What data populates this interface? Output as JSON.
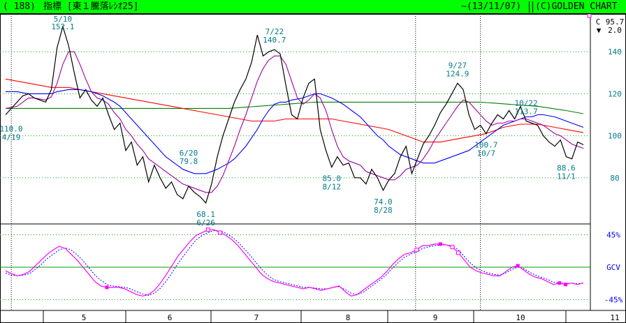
{
  "header": {
    "code": "( 188)",
    "title": "指標 [東１騰落ﾚｼｵ25]",
    "date": "~(13/11/07)",
    "brand": "(C)GOLDEN CHART"
  },
  "readout": {
    "last_prefix": "C",
    "last_value": "95.7",
    "change_symbol": "▼",
    "change_value": "2.0"
  },
  "colors": {
    "header_bg": "#00ff00",
    "price": "#000000",
    "ma_short": "#a000a0",
    "ma_mid": "#0000ff",
    "ma_long": "#ff0000",
    "ma_verylong": "#008000",
    "grid": "#00a000",
    "axis_text": "#007a8a",
    "osc_text": "#0000ff",
    "osc_line": "#ff00ff",
    "osc_dotted": "#0000ff",
    "marker": "#ff00ff"
  },
  "chart_data": {
    "type": "line",
    "upper": {
      "ylim": [
        58,
        158
      ],
      "ytick_labels": [
        "140",
        "120",
        "100",
        "80"
      ],
      "yticks": [
        140,
        120,
        100,
        80
      ],
      "series": [
        {
          "values": [
            110,
            113,
            116,
            119,
            120,
            118,
            117,
            116,
            122,
            142,
            152,
            143,
            130,
            118,
            122,
            117,
            114,
            118,
            110,
            103,
            106,
            93,
            97,
            86,
            90,
            78,
            86,
            80,
            75,
            78,
            72,
            70,
            76,
            73,
            71,
            68,
            77,
            90,
            100,
            108,
            116,
            122,
            127,
            135,
            148,
            138,
            140,
            141,
            139,
            124,
            110,
            108,
            118,
            125,
            127,
            103,
            93,
            85,
            90,
            86,
            87,
            80,
            80,
            77,
            84,
            80,
            74,
            79,
            82,
            90,
            95,
            82,
            89,
            96,
            100,
            105,
            111,
            115,
            120,
            125,
            122,
            110,
            103,
            105,
            101,
            106,
            110,
            108,
            112,
            108,
            114,
            107,
            106,
            105,
            100,
            97,
            95,
            98,
            90,
            89,
            97,
            95.7
          ]
        },
        {
          "values": [
            113,
            113.5,
            114,
            116,
            118,
            118,
            117.5,
            117,
            118.5,
            125,
            134,
            140,
            140,
            134,
            127,
            121,
            118,
            117,
            115,
            111,
            108,
            103,
            100,
            96,
            93,
            89,
            87,
            85,
            83,
            81,
            79,
            77,
            76,
            75,
            74,
            73,
            73,
            76,
            81,
            88,
            95,
            103,
            110,
            118,
            126,
            132,
            136,
            138,
            138,
            134,
            126,
            118,
            115,
            117,
            120,
            118,
            112,
            103,
            95,
            90,
            88,
            87,
            86,
            83,
            82,
            81,
            80,
            79,
            79,
            81,
            84,
            85,
            86,
            89,
            93,
            98,
            102,
            106,
            110,
            114,
            117,
            116,
            113,
            110,
            107,
            105,
            106,
            106,
            107,
            107,
            108,
            108,
            107,
            106,
            105,
            103,
            101,
            100,
            98,
            96,
            95,
            94
          ]
        },
        {
          "values": [
            121,
            121,
            121,
            120.5,
            120,
            120,
            120,
            120,
            120,
            121,
            121.5,
            122,
            122,
            122,
            121.5,
            121,
            120,
            119,
            117.5,
            116,
            114,
            111,
            108,
            105,
            102,
            99,
            96,
            93,
            90,
            88,
            86,
            84,
            83,
            82,
            82,
            82,
            83,
            84,
            85.5,
            87,
            89,
            92,
            95,
            99,
            103,
            108,
            112,
            115,
            116,
            116,
            117,
            117.5,
            118,
            119,
            120,
            120,
            119,
            118,
            116.5,
            115,
            113,
            111,
            109,
            106,
            103,
            100,
            98,
            95,
            93,
            91,
            90,
            89,
            88,
            87,
            87,
            87,
            88,
            89,
            90,
            91,
            92,
            93,
            95,
            97,
            99,
            101,
            103,
            105,
            106,
            107,
            108,
            109,
            109,
            110,
            110,
            109.5,
            109,
            108,
            107,
            106,
            105,
            104
          ]
        },
        {
          "values": [
            127,
            126.5,
            126,
            125.5,
            125,
            124.5,
            124,
            123.5,
            123,
            123,
            123,
            123,
            122.5,
            122,
            121.5,
            121,
            120.5,
            120,
            119.5,
            119,
            118.5,
            118,
            117.5,
            117,
            116.5,
            116,
            115.5,
            115,
            114.5,
            114,
            113.5,
            113,
            112.5,
            112,
            111.5,
            111,
            110.5,
            110,
            109.5,
            109,
            108.5,
            108,
            107.5,
            107,
            107,
            107,
            107,
            107,
            107.5,
            108,
            108,
            108,
            108,
            108,
            108,
            108,
            108,
            108,
            107.5,
            107,
            106.5,
            106,
            105.5,
            105,
            104.5,
            104,
            103.5,
            103,
            102,
            101,
            100,
            99,
            98,
            97,
            97,
            97,
            97,
            97.5,
            98,
            98.5,
            99,
            99.5,
            100,
            100.5,
            101,
            102,
            103,
            104,
            104.5,
            105,
            105.5,
            105.5,
            105.5,
            105.5,
            105,
            104.5,
            104,
            103.5,
            103,
            102.5,
            102,
            101.5
          ]
        },
        {
          "values": [
            113,
            113,
            113,
            113,
            113,
            113,
            113,
            113,
            113,
            113,
            113,
            113,
            113,
            113,
            113,
            113,
            113,
            113,
            113,
            113,
            113,
            113,
            113,
            113,
            113,
            113,
            113,
            113,
            113,
            113,
            113,
            113,
            113,
            113,
            113,
            113,
            113,
            113,
            113,
            113,
            113.2,
            113.4,
            113.6,
            113.8,
            114,
            114.2,
            114.4,
            114.6,
            114.8,
            115,
            115.2,
            115.4,
            115.6,
            115.8,
            116,
            116,
            116,
            116,
            116,
            116,
            116,
            116,
            116,
            116,
            116,
            116,
            116,
            116,
            116,
            116,
            116,
            116,
            116,
            116,
            116,
            116,
            116,
            116,
            116,
            116,
            116,
            116,
            116,
            116,
            115.8,
            115.6,
            115.4,
            115.2,
            115,
            114.8,
            114.6,
            114.4,
            114.2,
            114,
            113.6,
            113.2,
            112.8,
            112.4,
            112,
            111.5,
            111,
            110.5
          ]
        }
      ],
      "annotations": [
        {
          "date": "5/10",
          "value": "152.1",
          "index": 10,
          "pos": "above"
        },
        {
          "date": "7/22",
          "value": "140.7",
          "index": 47,
          "pos": "above"
        },
        {
          "date": "9/27",
          "value": "124.9",
          "index": 79,
          "pos": "above"
        },
        {
          "date": "10/22",
          "value": "113.7",
          "index": 91,
          "pos": "above"
        },
        {
          "date": "4/19",
          "value": "110.0",
          "index": 0,
          "pos": "below-left"
        },
        {
          "date": "6/20",
          "value": "79.8",
          "index": 32,
          "pos": "above-low"
        },
        {
          "date": "6/26",
          "value": "68.1",
          "index": 35,
          "pos": "below"
        },
        {
          "date": "8/12",
          "value": "85.0",
          "index": 57,
          "pos": "below"
        },
        {
          "date": "8/28",
          "value": "74.0",
          "index": 66,
          "pos": "below"
        },
        {
          "date": "10/7",
          "value": "100.7",
          "index": 84,
          "pos": "below"
        },
        {
          "date": "11/1",
          "value": "88.6",
          "index": 98,
          "pos": "below"
        }
      ]
    },
    "lower": {
      "ylim": [
        -60,
        60
      ],
      "ytick_labels": [
        "45%",
        "GCV",
        "-45%"
      ],
      "yticks": [
        45,
        0,
        -45
      ],
      "series": [
        {
          "values": [
            -5,
            -9,
            -12,
            -10,
            -6,
            2,
            10,
            18,
            24,
            29,
            26,
            18,
            10,
            0,
            -10,
            -20,
            -26,
            -28,
            -28,
            -28,
            -30,
            -34,
            -38,
            -40,
            -38,
            -32,
            -22,
            -10,
            3,
            16,
            26,
            36,
            44,
            48,
            52,
            52,
            48,
            44,
            38,
            30,
            20,
            10,
            0,
            -10,
            -16,
            -20,
            -22,
            -24,
            -26,
            -28,
            -30,
            -28,
            -30,
            -32,
            -30,
            -28,
            -26,
            -34,
            -40,
            -38,
            -32,
            -26,
            -20,
            -14,
            -6,
            4,
            12,
            18,
            20,
            24,
            30,
            30,
            32,
            32,
            31,
            28,
            20,
            10,
            0,
            -5,
            -8,
            -10,
            -12,
            -12,
            -6,
            0,
            2,
            -4,
            -10,
            -14,
            -16,
            -20,
            -24,
            -22,
            -24,
            -22,
            -24,
            -22
          ]
        },
        {
          "values": [
            -8,
            -11,
            -12,
            -11,
            -9,
            -3,
            4,
            12,
            18,
            24,
            27,
            24,
            17,
            9,
            -1,
            -11,
            -18,
            -24,
            -26,
            -27,
            -28,
            -30,
            -34,
            -37,
            -39,
            -36,
            -29,
            -19,
            -7,
            6,
            17,
            28,
            38,
            44,
            48,
            51,
            50,
            47,
            42,
            35,
            26,
            17,
            7,
            -3,
            -11,
            -17,
            -20,
            -22,
            -24,
            -26,
            -28,
            -28,
            -29,
            -30,
            -30,
            -28,
            -27,
            -31,
            -36,
            -38,
            -35,
            -29,
            -23,
            -17,
            -10,
            -1,
            7,
            14,
            18,
            21,
            26,
            28,
            30,
            31,
            31,
            29,
            24,
            15,
            6,
            -1,
            -5,
            -8,
            -10,
            -11,
            -8,
            -3,
            0,
            -2,
            -7,
            -11,
            -14,
            -17,
            -21,
            -22,
            -23,
            -22,
            -23,
            -22
          ]
        }
      ],
      "markers_filled": [
        17,
        73,
        86,
        93,
        94
      ],
      "markers_open": [
        34,
        36,
        69,
        75,
        76,
        98
      ]
    },
    "x_axis": {
      "tick_labels": [
        "5",
        "6",
        "7",
        "8",
        "9",
        "10",
        "11"
      ],
      "tick_indices": [
        4,
        25,
        45,
        65,
        85,
        107,
        128
      ]
    }
  }
}
